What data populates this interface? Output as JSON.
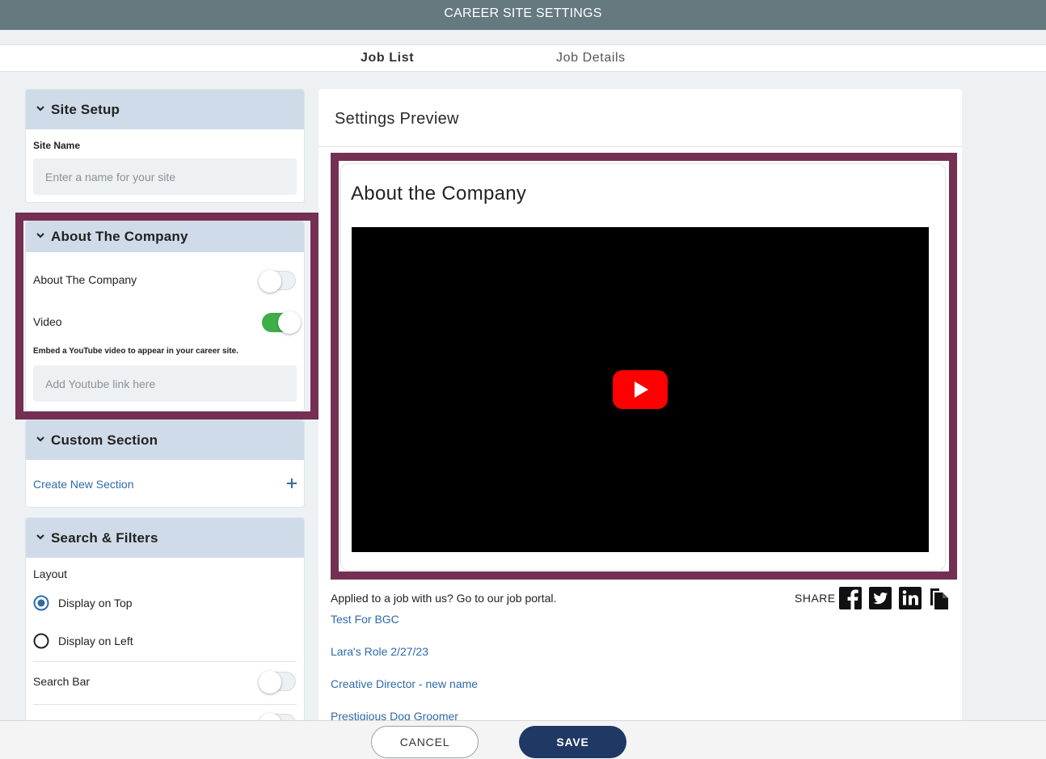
{
  "header": {
    "title": "CAREER SITE SETTINGS"
  },
  "tabs": [
    {
      "label": "Job List",
      "active": true
    },
    {
      "label": "Job Details",
      "active": false
    }
  ],
  "sidebar": {
    "site_setup": {
      "title": "Site Setup",
      "site_name_label": "Site Name",
      "site_name_placeholder": "Enter a name for your site",
      "site_name_value": ""
    },
    "about_company": {
      "title": "About The Company",
      "toggle_label": "About The Company",
      "toggle_on": false,
      "video_label": "Video",
      "video_on": true,
      "embed_hint": "Embed a YouTube video to appear in your career site.",
      "youtube_placeholder": "Add Youtube link here",
      "youtube_value": ""
    },
    "custom_section": {
      "title": "Custom Section",
      "create_label": "Create New Section",
      "create_icon": "plus-icon"
    },
    "search_filters": {
      "title": "Search & Filters",
      "layout_label": "Layout",
      "layout_options": [
        {
          "label": "Display on Top",
          "selected": true
        },
        {
          "label": "Display on Left",
          "selected": false
        }
      ],
      "search_bar_label": "Search Bar",
      "search_bar_on": false
    }
  },
  "preview": {
    "title": "Settings Preview",
    "company_title": "About the Company",
    "video_icon": "youtube-play-icon",
    "portal_text": "Applied to a job with us? Go to our job portal.",
    "share_label": "SHARE",
    "share_icons": [
      "facebook-icon",
      "twitter-icon",
      "linkedin-icon",
      "copy-icon"
    ],
    "jobs": [
      "Test For BGC",
      "Lara's Role 2/27/23",
      "Creative Director - new name",
      "Prestigious Dog Groomer"
    ]
  },
  "footer": {
    "cancel_label": "CANCEL",
    "save_label": "SAVE"
  },
  "colors": {
    "topbar": "#65797f",
    "panel_header": "#cfdbe8",
    "highlight": "#742f52",
    "toggle_on": "#3fae49",
    "link": "#2f6aa8",
    "save_button": "#1f3864",
    "youtube_red": "#ff0000"
  }
}
